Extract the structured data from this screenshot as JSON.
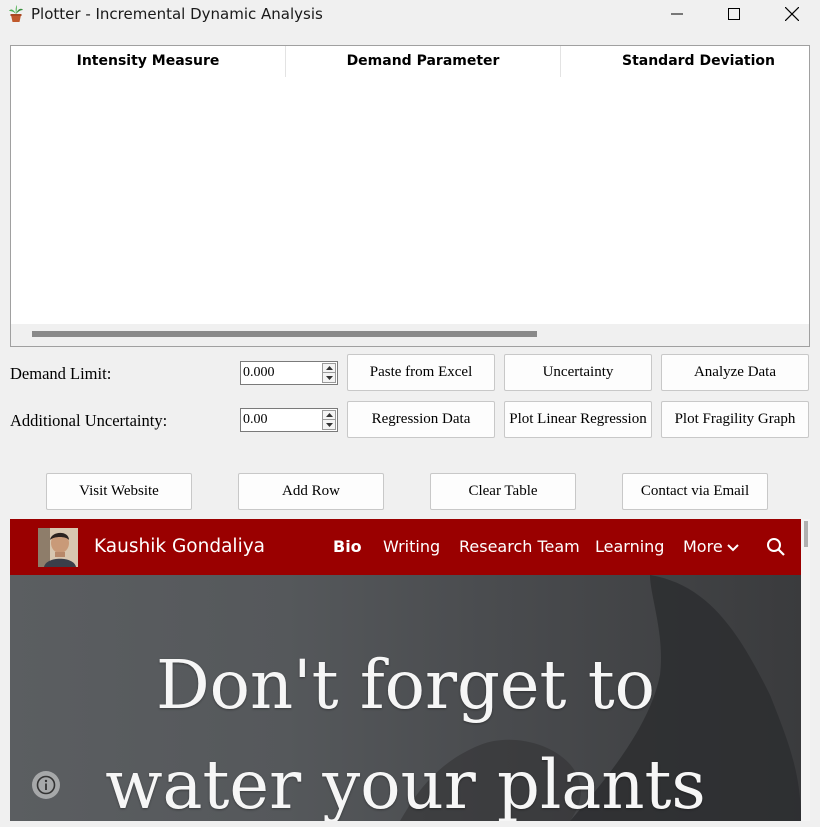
{
  "window": {
    "title": "Plotter - Incremental Dynamic Analysis",
    "icon": "potted-plant-icon"
  },
  "table": {
    "columns": [
      "Intensity Measure",
      "Demand Parameter",
      "Standard Deviation"
    ],
    "rows": []
  },
  "form": {
    "demand_limit_label": "Demand Limit:",
    "demand_limit_value": "0.000",
    "additional_uncertainty_label": "Additional Uncertainty:",
    "additional_uncertainty_value": "0.00"
  },
  "buttons": {
    "paste_from_excel": "Paste from Excel",
    "uncertainty": "Uncertainty",
    "analyze_data": "Analyze Data",
    "regression_data": "Regression Data",
    "plot_linear_regression": "Plot Linear Regression",
    "plot_fragility_graph": "Plot Fragility Graph",
    "visit_website": "Visit Website",
    "add_row": "Add Row",
    "clear_table": "Clear Table",
    "contact_via_email": "Contact via Email"
  },
  "website": {
    "site_name": "Kaushik Gondaliya",
    "nav": [
      "Bio",
      "Writing",
      "Research Team",
      "Learning",
      "More"
    ],
    "active_nav": "Bio",
    "hero_line1": "Don't forget to",
    "hero_line2": "water your plants",
    "nav_color": "#9a0000"
  }
}
